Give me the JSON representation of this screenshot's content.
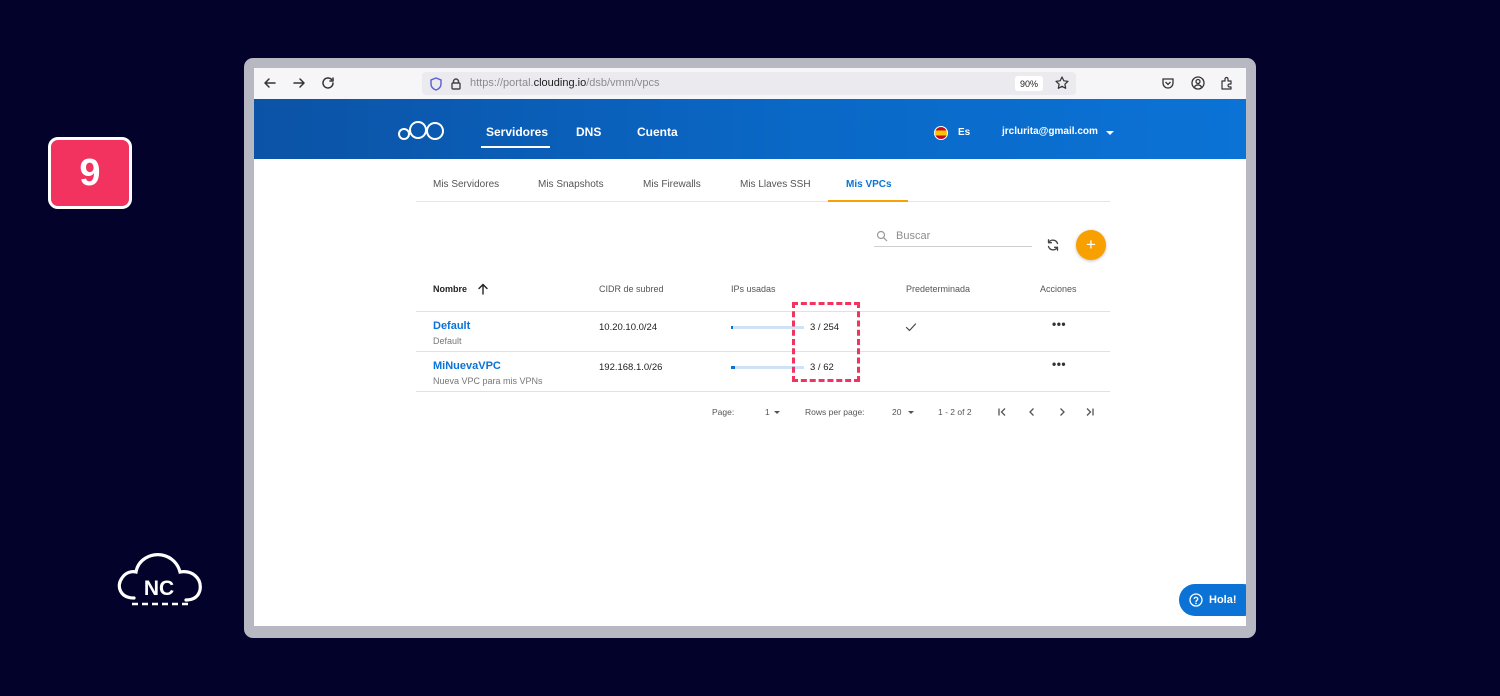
{
  "step_number": "9",
  "brand_logo": {
    "text": "NC"
  },
  "browser": {
    "url_prefix": "https://portal.",
    "url_domain": "clouding.io",
    "url_path": "/dsb/vmm/vpcs",
    "zoom": "90%"
  },
  "header": {
    "nav": [
      "Servidores",
      "DNS",
      "Cuenta"
    ],
    "active_nav": "Servidores",
    "language": "Es",
    "user_email": "jrclurita@gmail.com"
  },
  "subtabs": [
    "Mis Servidores",
    "Mis Snapshots",
    "Mis Firewalls",
    "Mis Llaves SSH",
    "Mis VPCs"
  ],
  "active_subtab": "Mis VPCs",
  "search": {
    "placeholder": "Buscar",
    "value": ""
  },
  "add_label": "+",
  "table": {
    "columns": [
      "Nombre",
      "CIDR de subred",
      "IPs usadas",
      "Predeterminada",
      "Acciones"
    ],
    "rows": [
      {
        "name": "Default",
        "description": "Default",
        "cidr": "10.20.10.0/24",
        "ips": "3 / 254",
        "ips_used_fraction": 0.012,
        "default": true,
        "actions": "•••"
      },
      {
        "name": "MiNuevaVPC",
        "description": "Nueva VPC para mis VPNs",
        "cidr": "192.168.1.0/26",
        "ips": "3 / 62",
        "ips_used_fraction": 0.048,
        "default": false,
        "actions": "•••"
      }
    ]
  },
  "pagination": {
    "page_label": "Page:",
    "page_value": "1",
    "rows_label": "Rows per page:",
    "rows_value": "20",
    "range": "1 - 2 of 2"
  },
  "chat": {
    "label": "Hola!"
  },
  "colors": {
    "brand_blue": "#0b73d6",
    "accent_orange": "#f7a000",
    "highlight_pink": "#f2325f",
    "background": "#02022a"
  }
}
